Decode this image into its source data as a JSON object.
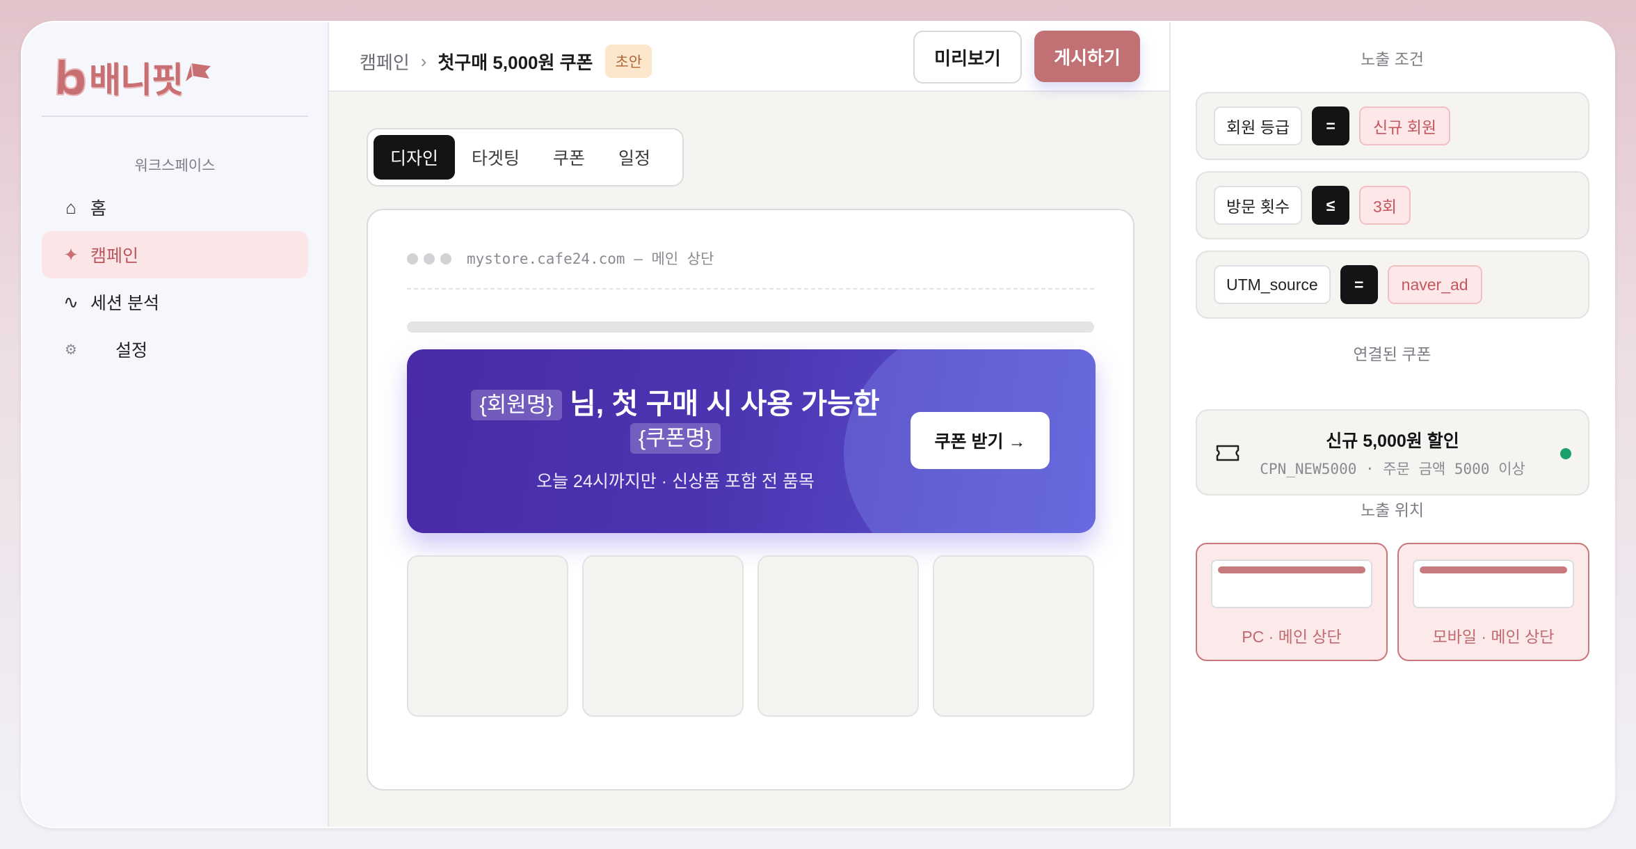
{
  "brand": {
    "name": "배니핏",
    "logo_letter": "b",
    "color": "#c76f73"
  },
  "sidebar": {
    "section_label": "워크스페이스",
    "items": [
      {
        "label": "홈",
        "icon": "home-icon",
        "glyph": "⌂",
        "active": false
      },
      {
        "label": "캠페인",
        "icon": "sparkle-icon",
        "glyph": "✦",
        "active": true
      },
      {
        "label": "세션 분석",
        "icon": "wave-icon",
        "glyph": "∿",
        "active": false
      },
      {
        "label": "설정",
        "icon": "gear-icon",
        "glyph": "⚙",
        "active": false
      }
    ]
  },
  "header": {
    "breadcrumb_root": "캠페인",
    "breadcrumb_separator": "›",
    "campaign_title": "첫구매 5,000원 쿠폰",
    "status_badge": "초안",
    "preview_label": "미리보기",
    "publish_label": "게시하기"
  },
  "tabs": [
    {
      "label": "디자인",
      "active": true
    },
    {
      "label": "타겟팅",
      "active": false
    },
    {
      "label": "쿠폰",
      "active": false
    },
    {
      "label": "일정",
      "active": false
    }
  ],
  "preview": {
    "url_text": "mystore.cafe24.com — 메인 상단",
    "banner": {
      "token_member": "{회원명}",
      "headline_text": "님, 첫 구매 시 사용 가능한",
      "token_coupon": "{쿠폰명}",
      "subtext": "오늘 24시까지만 · 신상품 포함 전 품목",
      "cta_label": "쿠폰 받기 →",
      "gradient_start": "#4a2aa6",
      "gradient_end": "#5a55d2"
    },
    "product_placeholders": 4
  },
  "panel": {
    "conditions_title": "노출 조건",
    "conditions": [
      {
        "field": "회원 등급",
        "operator": "=",
        "value": "신규 회원"
      },
      {
        "field": "방문 횟수",
        "operator": "≤",
        "value": "3회"
      },
      {
        "field": "UTM_source",
        "operator": "=",
        "value": "naver_ad"
      }
    ],
    "coupon_title": "연결된 쿠폰",
    "coupon": {
      "name": "신규 5,000원 할인",
      "meta": "CPN_NEW5000 · 주문 금액 5000 이상",
      "icon": "ticket-icon",
      "status_color": "#1aa06a"
    },
    "placement_title": "노출 위치",
    "placements": [
      {
        "label": "PC · 메인 상단"
      },
      {
        "label": "모바일 · 메인 상단"
      }
    ]
  }
}
